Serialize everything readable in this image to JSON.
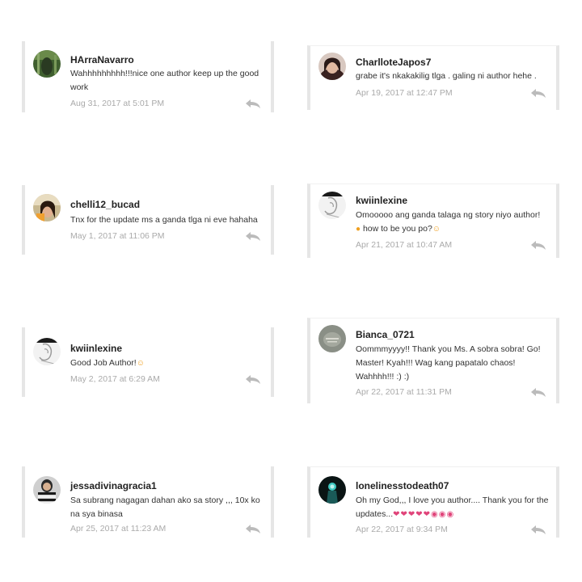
{
  "comments": [
    {
      "username": "HArraNavarro",
      "text": "Wahhhhhhhhh!!!nice one author keep up the good work",
      "timestamp": "Aug 31, 2017 at 5:01 PM",
      "avatar": "avatar-green-photo"
    },
    {
      "username": "CharlloteJapos7",
      "text": "grabe it's nkakakilig tlga . galing ni author hehe .",
      "timestamp": "Apr 19, 2017 at 12:47 PM",
      "avatar": "avatar-girl-photo"
    },
    {
      "username": "chelli12_bucad",
      "text": "Tnx for the update ms a ganda tlga ni eve hahaha",
      "timestamp": "May 1, 2017 at 11:06 PM",
      "avatar": "avatar-girl-photo"
    },
    {
      "username": "kwiinlexine",
      "text": "Omooooo ang ganda talaga ng story niyo author!",
      "text2": " how to be you po?",
      "timestamp": "Apr 21, 2017 at 10:47 AM",
      "avatar": "avatar-sketch-photo"
    },
    {
      "username": "kwiinlexine",
      "text": "Good Job Author!",
      "timestamp": "May 2, 2017 at 6:29 AM",
      "avatar": "avatar-sketch-photo"
    },
    {
      "username": "Bianca_0721",
      "text": "Oommmyyyy!! Thank you Ms. A sobra sobra! Go! Master! Kyah!!! Wag kang papatalo chaos! Wahhhh!!! :) :)",
      "timestamp": "Apr 22, 2017 at 11:31 PM",
      "avatar": "avatar-gray-photo"
    },
    {
      "username": "jessadivinagracia1",
      "text": "Sa subrang nagagan dahan ako sa story ,,, 10x ko na sya binasa",
      "timestamp": "Apr 25, 2017 at 11:23 AM",
      "avatar": "avatar-striped-photo"
    },
    {
      "username": "lonelinesstodeath07",
      "text": "Oh my God,,, I love you author.... Thank you for the updates...",
      "timestamp": "Apr 22, 2017 at 9:34 PM",
      "avatar": "avatar-dark-teal-photo"
    }
  ],
  "icons": {
    "reply": "reply-arrow-icon"
  },
  "colors": {
    "border": "#e6e6e6",
    "username": "#222222",
    "comment": "#333333",
    "timestamp": "#aaaaaa",
    "reply_icon": "#bbbbbb"
  }
}
